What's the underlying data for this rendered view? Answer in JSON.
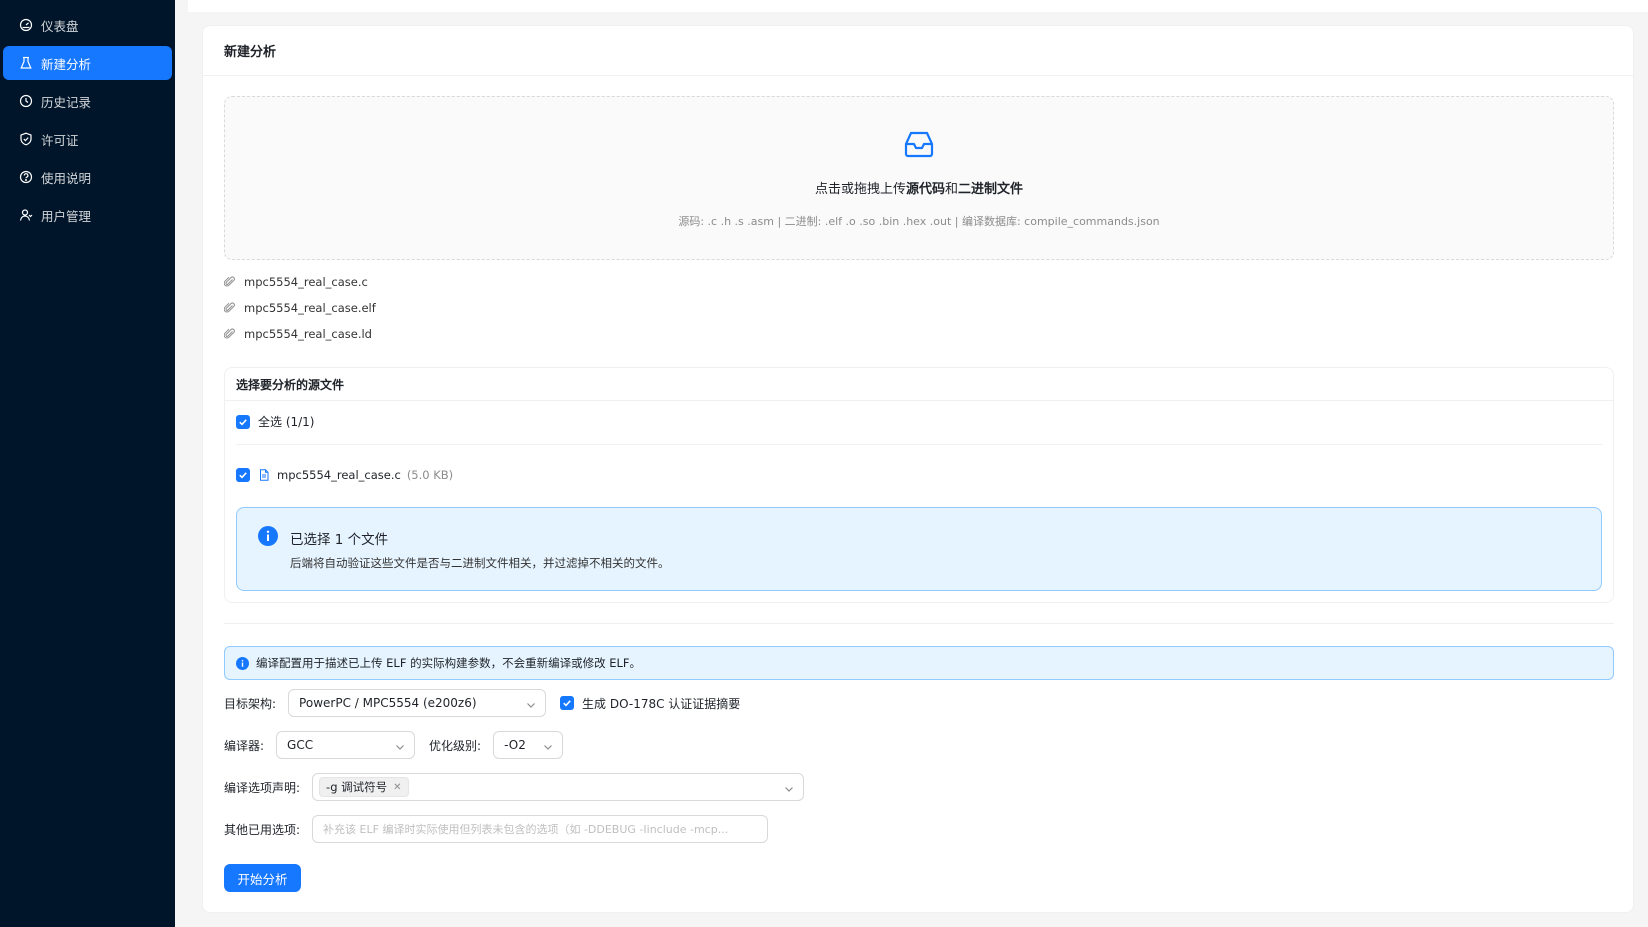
{
  "sidebar": {
    "items": [
      {
        "label": "仪表盘",
        "icon": "dashboard-icon"
      },
      {
        "label": "新建分析",
        "icon": "flask-icon"
      },
      {
        "label": "历史记录",
        "icon": "history-icon"
      },
      {
        "label": "许可证",
        "icon": "shield-icon"
      },
      {
        "label": "使用说明",
        "icon": "help-icon"
      },
      {
        "label": "用户管理",
        "icon": "users-icon"
      }
    ],
    "active_index": 1
  },
  "card": {
    "title": "新建分析"
  },
  "upload": {
    "title_prefix": "点击或拖拽上传",
    "title_bold1": "源代码",
    "title_mid": "和",
    "title_bold2": "二进制文件",
    "hint": "源码: .c .h .s .asm  |  二进制: .elf .o .so .bin .hex .out  |  编译数据库: compile_commands.json"
  },
  "uploaded_files": [
    "mpc5554_real_case.c",
    "mpc5554_real_case.elf",
    "mpc5554_real_case.ld"
  ],
  "source_select": {
    "title": "选择要分析的源文件",
    "select_all": "全选 (1/1)",
    "file_name": "mpc5554_real_case.c",
    "file_size": "(5.0 KB)",
    "alert_title": "已选择 1 个文件",
    "alert_desc": "后端将自动验证这些文件是否与二进制文件相关，并过滤掉不相关的文件。"
  },
  "config": {
    "info": "编译配置用于描述已上传 ELF 的实际构建参数，不会重新编译或修改 ELF。",
    "arch_label": "目标架构:",
    "arch_value": "PowerPC / MPC5554 (e200z6)",
    "do178_label": "生成 DO-178C 认证证据摘要",
    "compiler_label": "编译器:",
    "compiler_value": "GCC",
    "opt_label": "优化级别:",
    "opt_value": "-O2",
    "flags_label": "编译选项声明:",
    "flag_tag": "-g 调试符号",
    "other_label": "其他已用选项:",
    "other_placeholder": "补充该 ELF 编译时实际使用但列表未包含的选项（如 -DDEBUG -Iinclude -mcp...",
    "start_button": "开始分析"
  },
  "colors": {
    "sidebar_bg": "#001529",
    "accent": "#1677ff",
    "info_bg": "#e6f4ff",
    "info_border": "#91caff"
  }
}
